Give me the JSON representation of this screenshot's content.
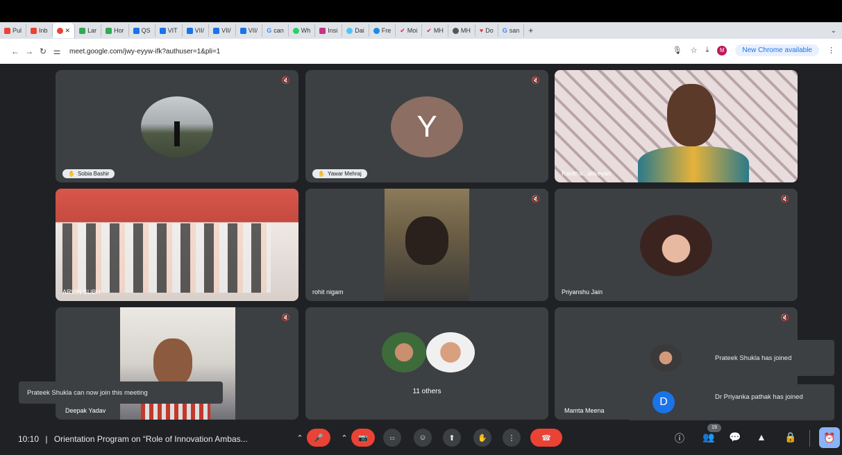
{
  "browser": {
    "tabs": [
      "Pul",
      "Inb",
      "",
      "Lar",
      "Hor",
      "QS",
      "VIT",
      "VII/",
      "VII/",
      "VII/",
      "can",
      "Wh",
      "Insi",
      "Dai",
      "Fre",
      "Moi",
      "MH",
      "MH",
      "Do",
      "san"
    ],
    "new_tab": "+",
    "url": "meet.google.com/jwy-eyyw-ifk?authuser=1&pli=1",
    "profile_initial": "M",
    "chrome_button": "New Chrome available"
  },
  "participants": {
    "sobia": {
      "name": "Sobia Bashir"
    },
    "yawar": {
      "name": "Yawar Mehraj",
      "initial": "Y"
    },
    "kavitha": {
      "name": "Kavitha...aIlkeyan"
    },
    "arvin": {
      "name": "ARVIN SUBH"
    },
    "rohit": {
      "name": "rohit nigam"
    },
    "priyanshu": {
      "name": "Priyanshu Jain"
    },
    "deepak": {
      "name": "Deepak Yadav"
    },
    "others": {
      "label": "11 others"
    },
    "mamta": {
      "name": "Mamta Meena"
    }
  },
  "toasts": {
    "prateek_now_join": "Prateek Shukla can now join this meeting",
    "prateek_joined": "Prateek Shukla has joined",
    "priyanka_joined": "Dr Priyanka pathak has joined",
    "priyanka_initial": "D"
  },
  "bottom": {
    "time": "10:10",
    "separator": "|",
    "meeting_title": "Orientation Program on “Role of Innovation Ambas...",
    "participant_count": "19"
  },
  "colors": {
    "end_call": "#ea4335",
    "accent": "#8ab4f8",
    "yawar_avatar": "#8d6e63",
    "priyanka_avatar": "#1a73e8"
  }
}
